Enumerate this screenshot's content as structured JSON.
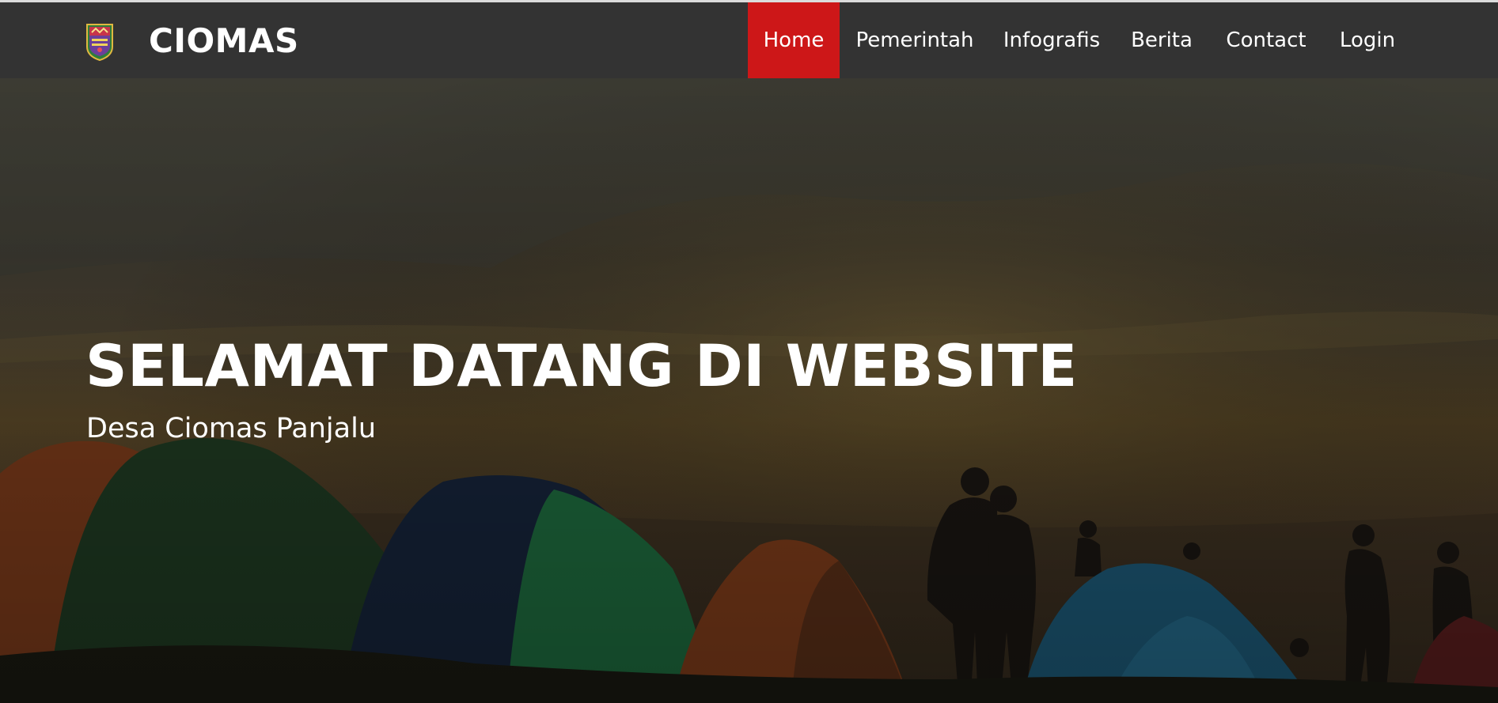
{
  "header": {
    "brand_name": "CIOMAS",
    "logo_icon": "village-crest-logo"
  },
  "nav": {
    "items": [
      {
        "label": "Home",
        "active": true
      },
      {
        "label": "Pemerintah",
        "active": false
      },
      {
        "label": "Infografis",
        "active": false
      },
      {
        "label": "Berita",
        "active": false
      },
      {
        "label": "Contact",
        "active": false
      },
      {
        "label": "Login",
        "active": false
      }
    ]
  },
  "hero": {
    "title": "SELAMAT DATANG DI WEBSITE",
    "subtitle": "Desa Ciomas Panjalu"
  },
  "colors": {
    "navbar": "#333333",
    "accent": "#cd1718",
    "text": "#ffffff"
  }
}
